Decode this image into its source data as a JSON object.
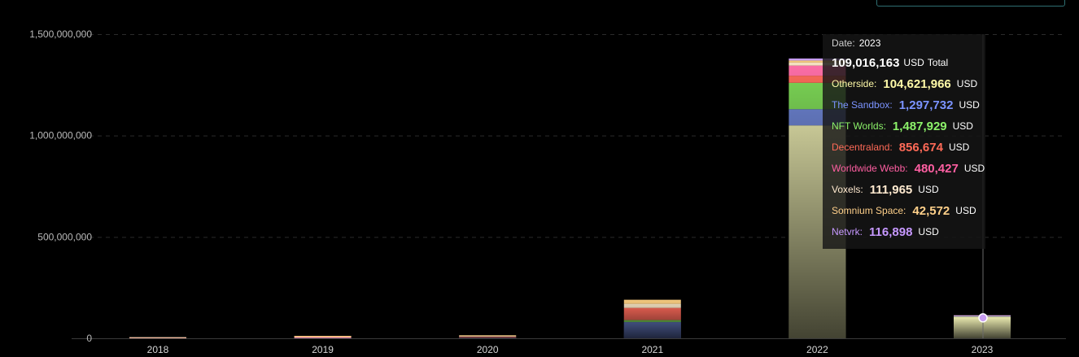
{
  "chart_data": {
    "type": "bar",
    "stacked": true,
    "categories": [
      "2018",
      "2019",
      "2020",
      "2021",
      "2022",
      "2023"
    ],
    "ylim": [
      0,
      1500000000
    ],
    "yticks": [
      {
        "value": 0,
        "label": "0"
      },
      {
        "value": 500000000,
        "label": "500,000,000"
      },
      {
        "value": 1000000000,
        "label": "1,000,000,000"
      },
      {
        "value": 1500000000,
        "label": "1,500,000,000"
      }
    ],
    "grid": true,
    "series": [
      {
        "name": "Otherside",
        "color": "#f0f0b4",
        "values": [
          0,
          0,
          0,
          0,
          1050000000,
          104621966
        ]
      },
      {
        "name": "The Sandbox",
        "color": "#6f86d6",
        "values": [
          0,
          2000000,
          3000000,
          80000000,
          80000000,
          1297732
        ]
      },
      {
        "name": "NFT Worlds",
        "color": "#7ed957",
        "values": [
          0,
          0,
          0,
          10000000,
          130000000,
          1487929
        ]
      },
      {
        "name": "Decentraland",
        "color": "#ff6b5b",
        "values": [
          1500000,
          4000000,
          5000000,
          60000000,
          35000000,
          856674
        ]
      },
      {
        "name": "Worldwide Webb",
        "color": "#ff6fa8",
        "values": [
          0,
          0,
          0,
          0,
          50000000,
          480427
        ]
      },
      {
        "name": "Voxels",
        "color": "#f6e3c3",
        "values": [
          500000,
          2000000,
          3000000,
          20000000,
          15000000,
          111965
        ]
      },
      {
        "name": "Somnium Space",
        "color": "#f5c97e",
        "values": [
          0,
          2000000,
          3000000,
          20000000,
          10000000,
          42572
        ]
      },
      {
        "name": "Netvrk",
        "color": "#c69cf2",
        "values": [
          0,
          0,
          0,
          0,
          10000000,
          116898
        ]
      }
    ],
    "tooltip": {
      "date_label": "Date:",
      "date": "2023",
      "total_value": "109,016,163",
      "total_unit": "USD",
      "total_label": "Total",
      "unit": "USD",
      "items": [
        {
          "label": "Otherside:",
          "value": "104,621,966",
          "color": "#fffaa8"
        },
        {
          "label": "The Sandbox:",
          "value": "1,297,732",
          "color": "#7b93ff"
        },
        {
          "label": "NFT Worlds:",
          "value": "1,487,929",
          "color": "#8cf26a"
        },
        {
          "label": "Decentraland:",
          "value": "856,674",
          "color": "#ff6a57"
        },
        {
          "label": "Worldwide Webb:",
          "value": "480,427",
          "color": "#ff5fa2"
        },
        {
          "label": "Voxels:",
          "value": "111,965",
          "color": "#ffe9cf"
        },
        {
          "label": "Somnium Space:",
          "value": "42,572",
          "color": "#ffd08a"
        },
        {
          "label": "Netvrk:",
          "value": "116,898",
          "color": "#c698ff"
        }
      ]
    },
    "hover_category": "2023"
  }
}
